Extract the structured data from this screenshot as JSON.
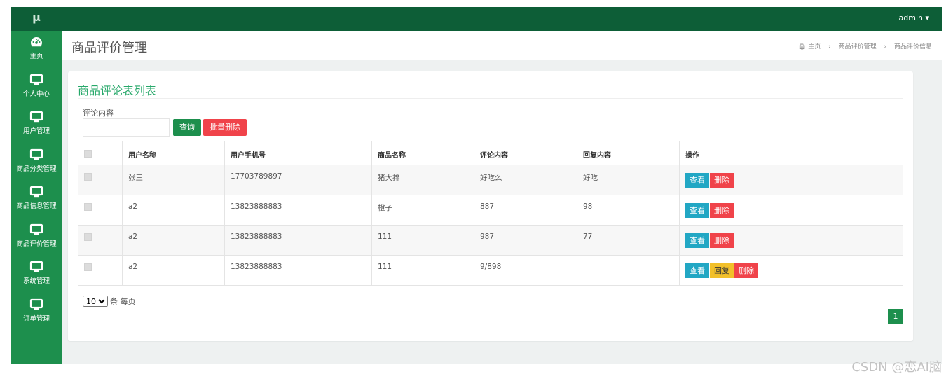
{
  "app": {
    "logo": "μ",
    "user": "admin ▾"
  },
  "sidebar": {
    "items": [
      {
        "label": "主页",
        "icon": "dashboard-icon"
      },
      {
        "label": "个人中心",
        "icon": "monitor-icon"
      },
      {
        "label": "用户管理",
        "icon": "monitor-icon"
      },
      {
        "label": "商品分类管理",
        "icon": "monitor-icon"
      },
      {
        "label": "商品信息管理",
        "icon": "monitor-icon"
      },
      {
        "label": "商品评价管理",
        "icon": "monitor-icon"
      },
      {
        "label": "系统管理",
        "icon": "monitor-icon"
      },
      {
        "label": "订单管理",
        "icon": "monitor-icon"
      }
    ]
  },
  "header": {
    "title": "商品评价管理",
    "breadcrumb": [
      "主页",
      "商品评价管理",
      "商品评价信息"
    ]
  },
  "panel": {
    "title": "商品评论表列表",
    "search_label": "评论内容",
    "search_value": "",
    "query_button": "查询",
    "batch_delete_button": "批量删除"
  },
  "table": {
    "columns": [
      "用户名称",
      "用户手机号",
      "商品名称",
      "评论内容",
      "回复内容",
      "操作"
    ],
    "rows": [
      {
        "user": "张三",
        "phone": "17703789897",
        "product": "猪大排",
        "comment": "好吃么",
        "reply": "好吃",
        "actions": [
          "查看",
          "删除"
        ]
      },
      {
        "user": "a2",
        "phone": "13823888883",
        "product": "橙子",
        "comment": "887",
        "reply": "98",
        "actions": [
          "查看",
          "删除"
        ]
      },
      {
        "user": "a2",
        "phone": "13823888883",
        "product": "111",
        "comment": "987",
        "reply": "77",
        "actions": [
          "查看",
          "删除"
        ]
      },
      {
        "user": "a2",
        "phone": "13823888883",
        "product": "111",
        "comment": "9/898",
        "reply": "",
        "actions": [
          "查看",
          "回复",
          "删除"
        ]
      }
    ]
  },
  "pager": {
    "page_size": "10",
    "per_page_text": "条 每页",
    "current_page": "1"
  },
  "watermark": "CSDN @恋AI脑",
  "colors": {
    "primary": "#1d8f4d",
    "dark": "#0d5e37",
    "danger": "#f0434a",
    "info": "#22a7c4",
    "warning": "#f2c02a"
  }
}
